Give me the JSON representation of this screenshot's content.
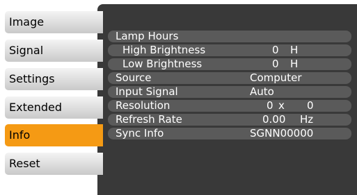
{
  "menu": {
    "items": [
      {
        "label": "Image"
      },
      {
        "label": "Signal"
      },
      {
        "label": "Settings"
      },
      {
        "label": "Extended"
      },
      {
        "label": "Info"
      },
      {
        "label": "Reset"
      }
    ],
    "active_index": 4
  },
  "info": {
    "lamp_hours_label": "Lamp Hours",
    "high_brightness": {
      "label": "High Brightness",
      "value": "0",
      "unit": "H"
    },
    "low_brightness": {
      "label": "Low Brightness",
      "value": "0",
      "unit": "H"
    },
    "source": {
      "label": "Source",
      "value": "Computer"
    },
    "input_signal": {
      "label": "Input Signal",
      "value": "Auto"
    },
    "resolution": {
      "label": "Resolution",
      "width": "0",
      "sep": "x",
      "height": "0"
    },
    "refresh_rate": {
      "label": "Refresh Rate",
      "value": "0.00",
      "unit": "Hz"
    },
    "sync_info": {
      "label": "Sync Info",
      "value": "SGNN00000"
    }
  },
  "colors": {
    "panel": "#393939",
    "row": "#5a5a5a",
    "active": "#f59a14"
  }
}
